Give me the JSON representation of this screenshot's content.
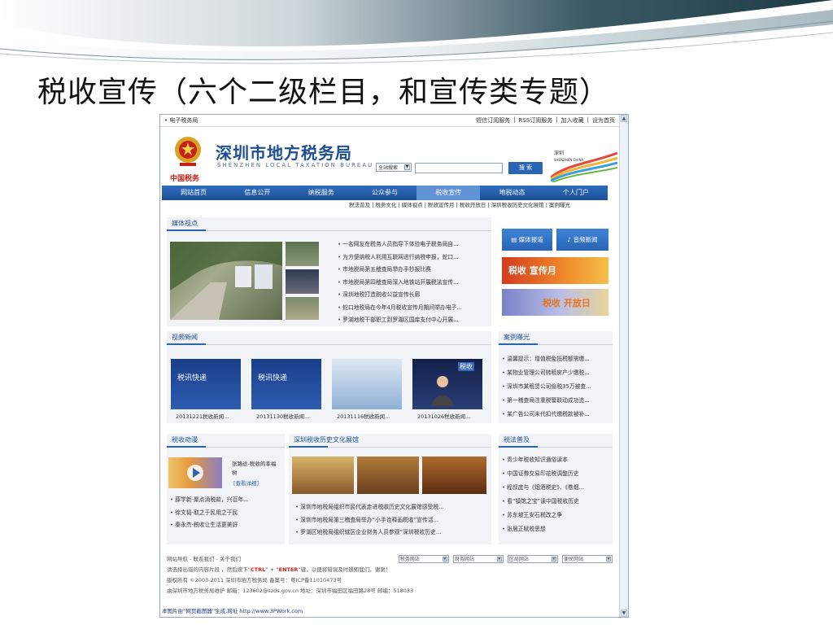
{
  "slide": {
    "title": "税收宣传（六个二级栏目，和宣传类专题）"
  },
  "browser": {
    "scroll_up": "▲",
    "scroll_down": "▼"
  },
  "site": {
    "topbar_left": "• 电子税务局",
    "topbar_links": [
      "短信订阅服务",
      "|",
      "RSS订阅服务",
      "|",
      "加入收藏",
      "|",
      "设为首页"
    ],
    "logo_brand": "中国税务",
    "name": "深圳市地方税务局",
    "name_en": "SHENZHEN LOCAL TAXATION BUREAU",
    "search_scope": "全站搜索",
    "search_placeholder": "",
    "search_button": "搜 索",
    "sz_logo_text": "深圳 SHENZHEN CHINA",
    "nav": [
      "网站首页",
      "信息公开",
      "纳税服务",
      "公众参与",
      "税收宣传",
      "地税动态",
      "个人门户"
    ],
    "active_nav": "税收宣传",
    "subnav": "税法普及 | 税务文化 | 媒体视点 | 税收宣传月 | 税收开放日 | 深圳税收历史文化展馆 | 案例曝光"
  },
  "media": {
    "title": "媒体视点",
    "items": [
      "一名网友在税务人员指导下体验电子税务局自...",
      "为方便纳税人利用互联网进行纳税申报，蛇口...",
      "市地税局第五稽查局举办手抄报比赛",
      "市地税局第四稽查局深入地铁站开展税法宣传...",
      "深圳地税打造税收公益宣传长廊",
      "蛇口地税局在今年4月税收宣传月期间举办电子...",
      "罗湖地税干部职工到罗湖区国库支付中心开展..."
    ]
  },
  "quick": {
    "media_report": "媒体报道",
    "audio_news": "音频新闻",
    "tax_month": "税收 宣传月",
    "open_day": "税收 开放日"
  },
  "video": {
    "title": "视频新闻",
    "items": [
      {
        "caption": "20131221税收新闻...",
        "overlay": "税讯快递"
      },
      {
        "caption": "20131130税收新闻...",
        "overlay": "税讯快递"
      },
      {
        "caption": "20131116税收新闻...",
        "overlay": ""
      },
      {
        "caption": "20131026税收新闻...",
        "overlay": "税收"
      }
    ]
  },
  "cases": {
    "title": "案例曝光",
    "items": [
      "温馨提示：增值税免抵税额需缴...",
      "某物业管理公司转租房产少缴税...",
      "深圳市某租赁公司偷税35万被查...",
      "第一稽查局注重税警联动成功追...",
      "某广告公司未代扣代缴税款被补..."
    ]
  },
  "comic": {
    "title": "税收动漫",
    "feature_title": "张路途-税收的幸福树",
    "feature_link": "[查看详细]",
    "items": [
      "薛学新-聚点滴税款，兴百年...",
      "徐文韬-取之于民用之于民",
      "秦永杰-税收让生活更美好"
    ]
  },
  "museum": {
    "title": "深圳税收历史文化展馆",
    "items": [
      "深圳市地税局组织市民代表走进税收历史文化展馆感受税...",
      "深圳市地税局第三稽查局举办“小手诠释画税收”宣传活...",
      "罗湖区地税局组织辖区企业财务人员参观“深圳税收历史..."
    ]
  },
  "law": {
    "title": "税法普及",
    "items": [
      "青少年税收知识通俗读本",
      "中国证券交易印花税调整历史",
      "程叔度与《烟酒税史》、《卷烟...",
      "看“镇馆之宝”读中国税收历史",
      "苏东坡王安石税改之争",
      "张居正赋税思想"
    ]
  },
  "footer": {
    "nav_line": "网站导航 ‑ 联系我们 ‑ 关于我们",
    "selects": [
      "税务网站",
      "财务网站",
      "区局网站",
      "便民网站"
    ],
    "select_arrow": "▼",
    "tip_prefix": "请选择出错的内容片段 ，然后按下“",
    "tip_ctrl": "CTRL",
    "tip_mid": "” + “",
    "tip_enter": "ENTER",
    "tip_suffix": "”键，以便将错误及时通知我们，谢谢！",
    "copyright": "版权所有 ©2003-2011 深圳市地方税务局  备案号：粤ICP备11010473号",
    "maintain": "由深圳市地方税务局维护  邮箱：123602@szds.gov.cn  地址：深圳市福田区福田路28号  邮编：518033"
  },
  "credit": "本图片由“网页截图器”生成,网址 http://www.3PWork.com"
}
